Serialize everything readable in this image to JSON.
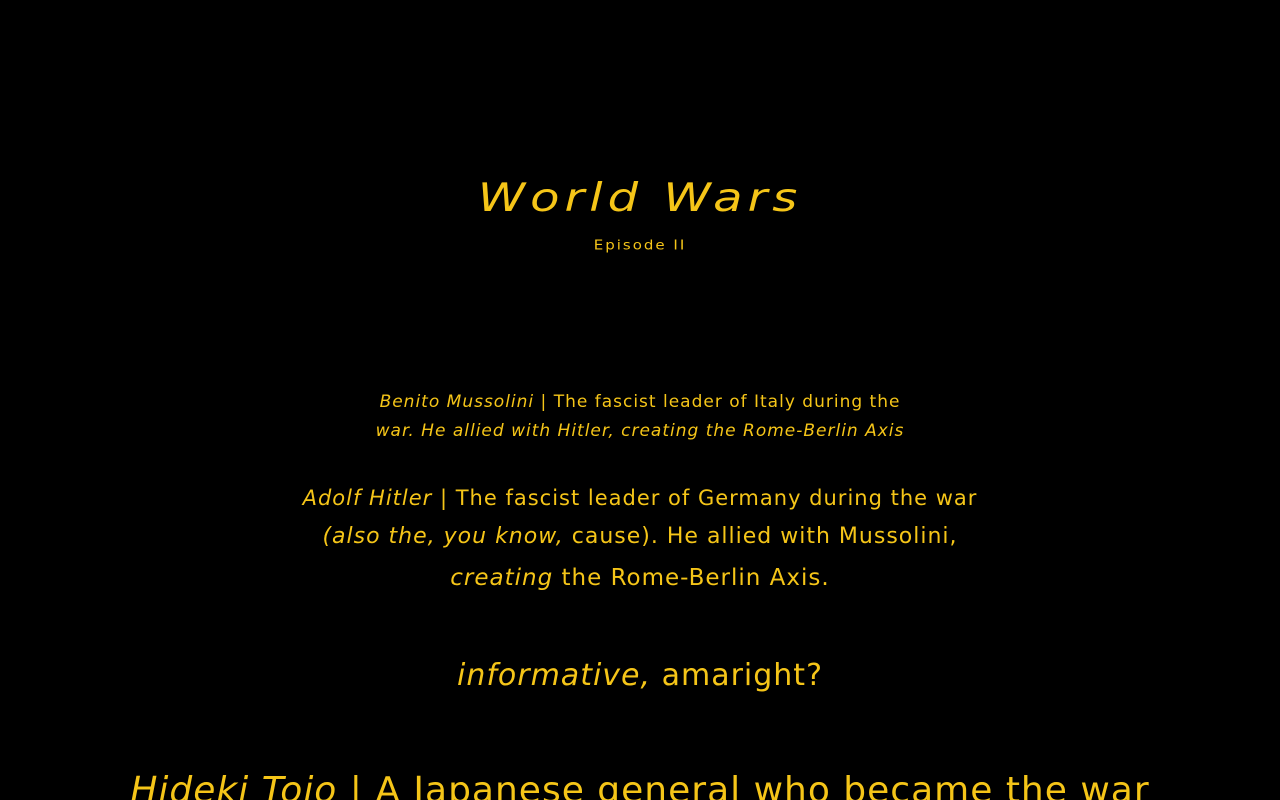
{
  "crawl": {
    "title": "World Wars",
    "subtitle": "Episode II",
    "lines": [
      {
        "italic": "Benito Mussolini",
        "rest": " | The fascist leader of Italy during the"
      },
      {
        "italic": "war.  He allied with Hitler, creating the Rome-Berlin Axis",
        "rest": ""
      },
      {
        "italic": "Adolf Hitler",
        "rest": " | The fascist leader of Germany during the war"
      },
      {
        "italic": "(also the, you know,",
        "rest": " cause).  He allied with Mussolini,"
      },
      {
        "italic": "creating",
        "rest": " the Rome-Berlin Axis."
      },
      {
        "italic": "informative,",
        "rest": " amaright?"
      },
      {
        "italic": "Hideki Tojo",
        "rest": " | A Japanese general who became the war"
      }
    ]
  },
  "colors": {
    "background": "#000000",
    "text": "#f5c518"
  }
}
